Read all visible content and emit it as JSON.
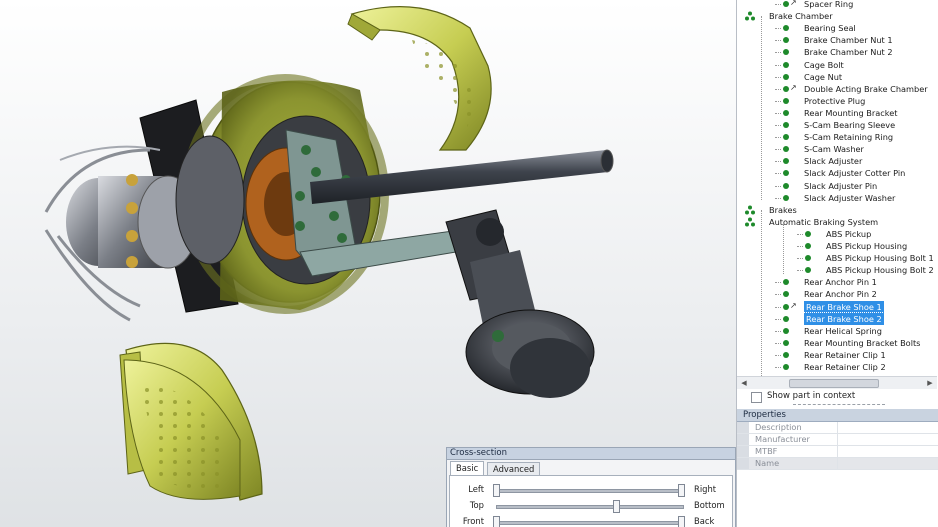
{
  "tree": {
    "items": [
      {
        "label": "Spacer Ring",
        "icon": "part-multi",
        "depth": 2
      },
      {
        "label": "Brake Chamber",
        "icon": "assembly",
        "depth": 0
      },
      {
        "label": "Bearing Seal",
        "icon": "part",
        "depth": 2
      },
      {
        "label": "Brake Chamber Nut 1",
        "icon": "part",
        "depth": 2
      },
      {
        "label": "Brake Chamber Nut 2",
        "icon": "part",
        "depth": 2
      },
      {
        "label": "Cage Bolt",
        "icon": "part",
        "depth": 2
      },
      {
        "label": "Cage Nut",
        "icon": "part",
        "depth": 2
      },
      {
        "label": "Double Acting Brake Chamber",
        "icon": "part-multi",
        "depth": 2
      },
      {
        "label": "Protective Plug",
        "icon": "part",
        "depth": 2
      },
      {
        "label": "Rear Mounting Bracket",
        "icon": "part",
        "depth": 2
      },
      {
        "label": "S-Cam Bearing Sleeve",
        "icon": "part",
        "depth": 2
      },
      {
        "label": "S-Cam Retaining Ring",
        "icon": "part",
        "depth": 2
      },
      {
        "label": "S-Cam Washer",
        "icon": "part",
        "depth": 2
      },
      {
        "label": "Slack Adjuster",
        "icon": "part",
        "depth": 2
      },
      {
        "label": "Slack Adjuster Cotter Pin",
        "icon": "part",
        "depth": 2
      },
      {
        "label": "Slack Adjuster Pin",
        "icon": "part",
        "depth": 2
      },
      {
        "label": "Slack Adjuster Washer",
        "icon": "part",
        "depth": 2
      },
      {
        "label": "Brakes",
        "icon": "assembly",
        "depth": 0
      },
      {
        "label": "Automatic Braking System",
        "icon": "assembly",
        "depth": 1
      },
      {
        "label": "ABS Pickup",
        "icon": "part",
        "depth": 3
      },
      {
        "label": "ABS Pickup Housing",
        "icon": "part",
        "depth": 3
      },
      {
        "label": "ABS Pickup Housing Bolt 1",
        "icon": "part",
        "depth": 3
      },
      {
        "label": "ABS Pickup Housing Bolt 2",
        "icon": "part",
        "depth": 3
      },
      {
        "label": "Rear Anchor Pin 1",
        "icon": "part",
        "depth": 2
      },
      {
        "label": "Rear Anchor Pin 2",
        "icon": "part",
        "depth": 2
      },
      {
        "label": "Rear Brake Shoe 1",
        "icon": "part-multi",
        "depth": 2,
        "selected": true
      },
      {
        "label": "Rear Brake Shoe 2",
        "icon": "part",
        "depth": 2,
        "selected": true
      },
      {
        "label": "Rear Helical Spring",
        "icon": "part",
        "depth": 2
      },
      {
        "label": "Rear Mounting Bracket Bolts",
        "icon": "part",
        "depth": 2
      },
      {
        "label": "Rear Retainer Clip 1",
        "icon": "part",
        "depth": 2
      },
      {
        "label": "Rear Retainer Clip 2",
        "icon": "part",
        "depth": 2
      }
    ]
  },
  "context": {
    "label": "Show part in context",
    "checked": false
  },
  "properties": {
    "title": "Properties",
    "rows": [
      "Description",
      "Manufacturer",
      "MTBF",
      "Name"
    ]
  },
  "cross_section": {
    "title": "Cross-section",
    "tabs": [
      "Basic",
      "Advanced"
    ],
    "active_tab": "Basic",
    "sliders": [
      {
        "left": "Left",
        "right": "Right",
        "value": 0.0
      },
      {
        "left": "Top",
        "right": "Bottom",
        "value": 0.65
      },
      {
        "left": "Front",
        "right": "Back",
        "value": 0.0
      }
    ]
  },
  "colors": {
    "selection": "#2f8fe6",
    "tree_dot": "#1e8a2b",
    "brake_shoe": "#c8cf55",
    "drum": "#9ea83a"
  }
}
